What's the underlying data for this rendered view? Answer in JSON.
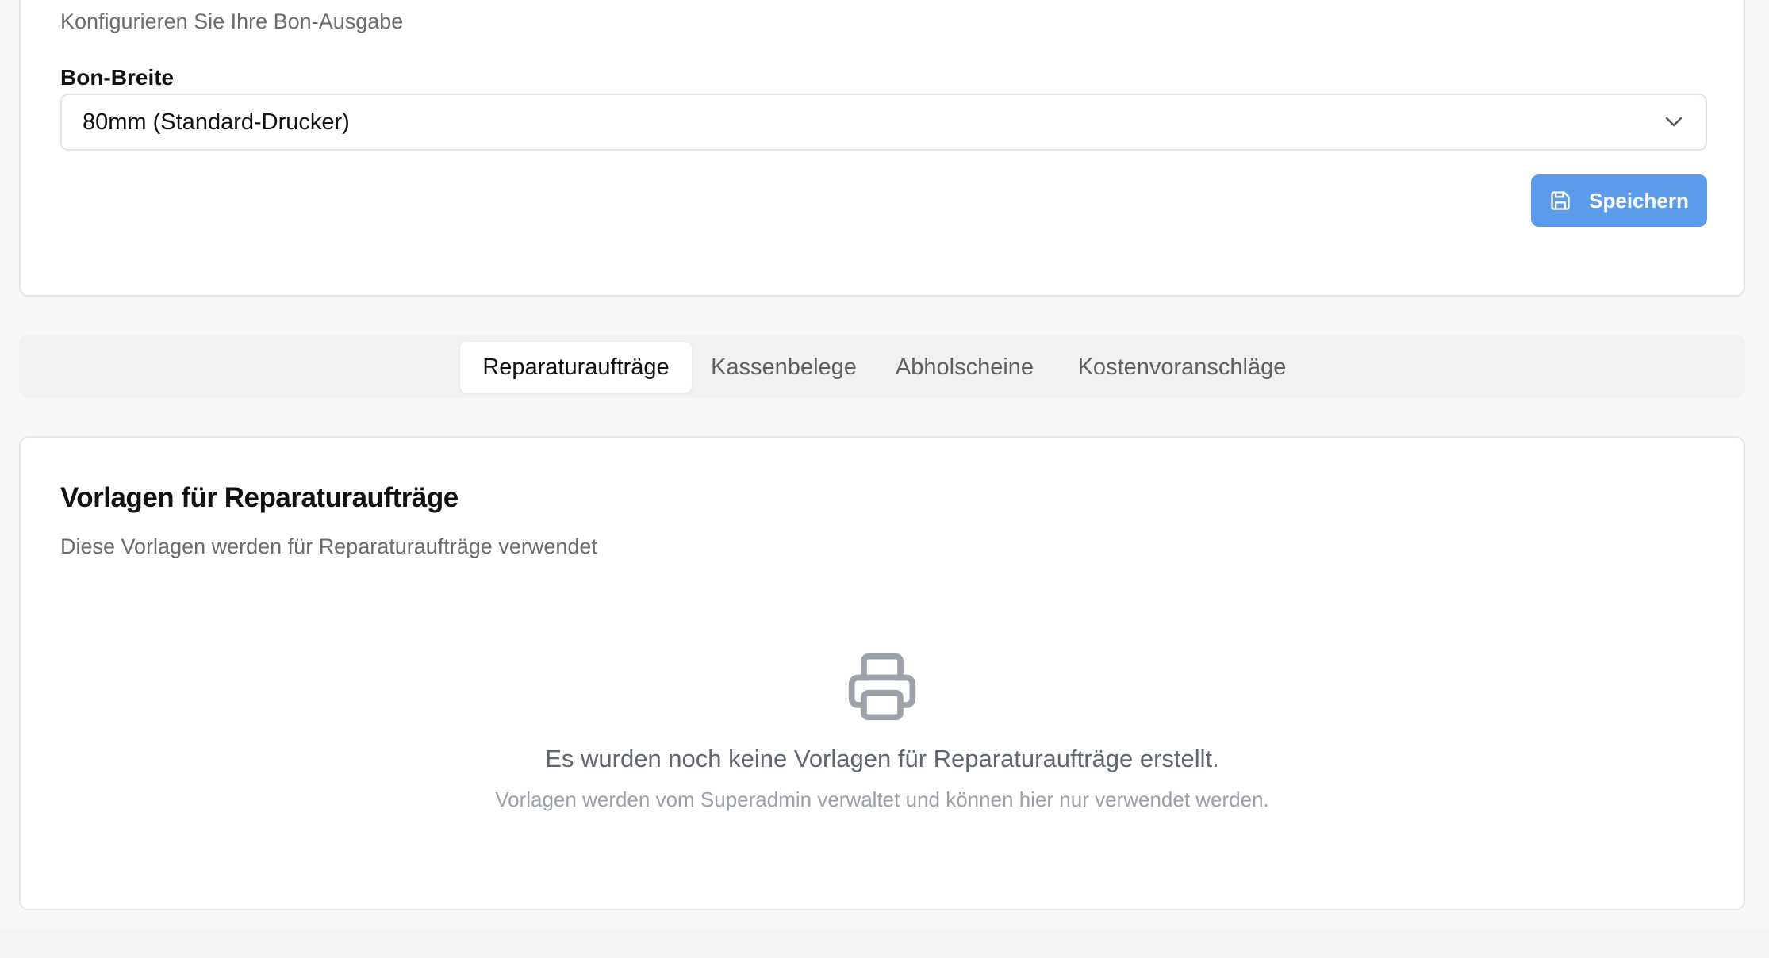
{
  "settings": {
    "subtitle": "Konfigurieren Sie Ihre Bon-Ausgabe",
    "width_label": "Bon-Breite",
    "width_value": "80mm (Standard-Drucker)",
    "save_label": "Speichern"
  },
  "tabs": [
    {
      "label": "Reparaturaufträge",
      "active": true
    },
    {
      "label": "Kassenbelege",
      "active": false
    },
    {
      "label": "Abholscheine",
      "active": false
    },
    {
      "label": "Kostenvoranschläge",
      "active": false
    }
  ],
  "templates": {
    "title": "Vorlagen für Reparaturaufträge",
    "description": "Diese Vorlagen werden für Reparaturaufträge verwendet",
    "empty_title": "Es wurden noch keine Vorlagen für Reparaturaufträge erstellt.",
    "empty_subtitle": "Vorlagen werden vom Superadmin verwaltet und können hier nur verwendet werden."
  },
  "icons": {
    "save": "save-icon",
    "chevron": "chevron-down-icon",
    "printer": "printer-icon"
  },
  "colors": {
    "primary": "#5b9bea",
    "background": "#f7f7f7",
    "card": "#ffffff"
  }
}
